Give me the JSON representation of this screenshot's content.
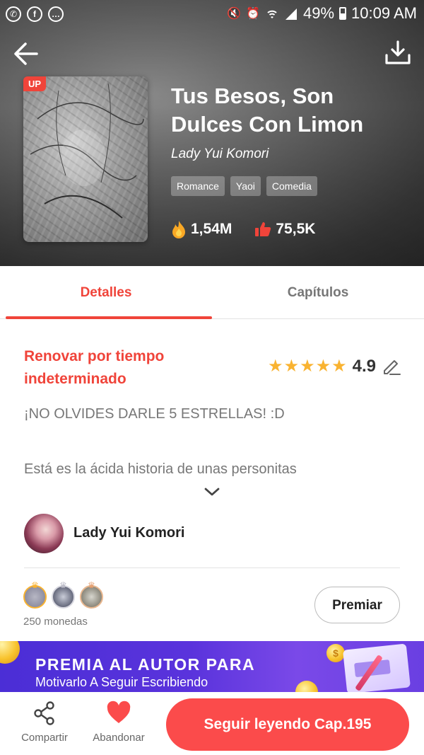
{
  "status_bar": {
    "battery": "49%",
    "time": "10:09 AM"
  },
  "book": {
    "badge": "UP",
    "title": "Tus Besos, Son Dulces Con Limon",
    "author": "Lady Yui Komori",
    "tags": [
      "Romance",
      "Yaoi",
      "Comedia"
    ],
    "views": "1,54M",
    "likes": "75,5K"
  },
  "tabs": [
    {
      "label": "Detalles",
      "active": true
    },
    {
      "label": "Capítulos",
      "active": false
    }
  ],
  "details": {
    "status": "Renovar por tiempo indeterminado",
    "rating": "4.9",
    "note": "¡NO OLVIDES DARLE 5 ESTRELLAS! :D",
    "synopsis": "Está es la ácida historia de unas personitas"
  },
  "author_row": {
    "name": "Lady Yui Komori"
  },
  "donations": {
    "coins": "250 monedas",
    "button": "Premiar"
  },
  "banner": {
    "title": "PREMIA AL AUTOR PARA",
    "subtitle": "Motivarlo A Seguir Escribiendo"
  },
  "bottom_bar": {
    "share": "Compartir",
    "abandon": "Abandonar",
    "continue": "Seguir leyendo Cap.195"
  },
  "colors": {
    "accent": "#f0443a",
    "star": "#f9b331",
    "banner": "#5a33dc"
  }
}
